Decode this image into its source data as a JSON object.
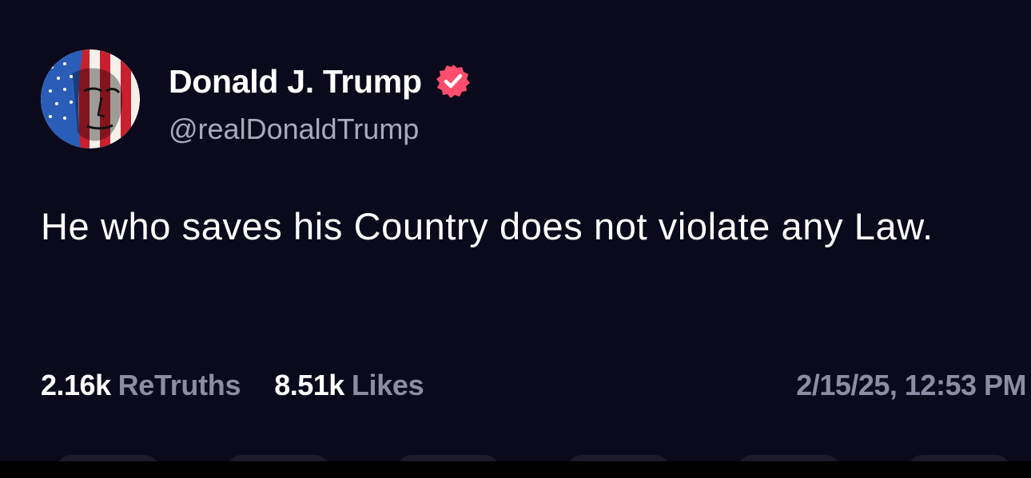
{
  "author": {
    "display_name": "Donald J. Trump",
    "handle": "@realDonaldTrump",
    "verified_icon": "verified-badge-icon",
    "badge_color": "#ff4d6d"
  },
  "post": {
    "text": "He who saves his Country does not violate any Law."
  },
  "stats": {
    "retruths_count": "2.16k",
    "retruths_label": "ReTruths",
    "likes_count": "8.51k",
    "likes_label": "Likes",
    "timestamp": "2/15/25, 12:53 PM"
  },
  "colors": {
    "background": "#0b0a1c",
    "text_primary": "#ffffff",
    "text_secondary": "#8d8ca3"
  }
}
